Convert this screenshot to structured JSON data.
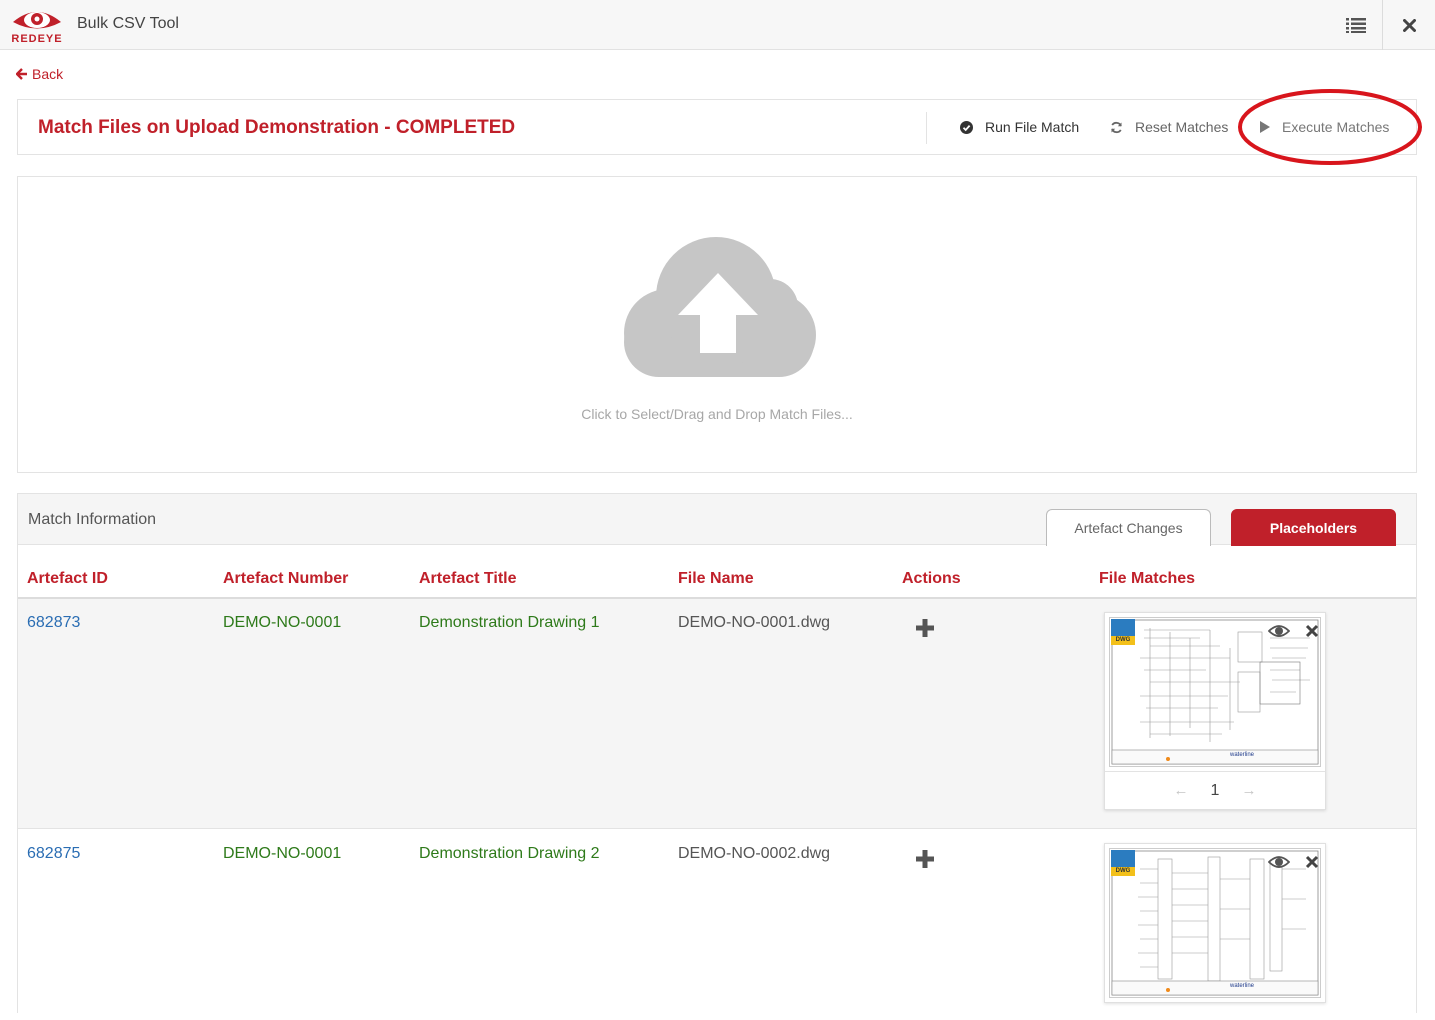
{
  "app": {
    "title": "Bulk CSV Tool",
    "logo_text": "REDEYE"
  },
  "icons": {
    "list": "list-icon",
    "close": "close-icon",
    "back": "arrow-left-icon",
    "run": "check-circle-icon",
    "reset": "refresh-icon",
    "execute": "play-icon",
    "upload": "cloud-upload-icon",
    "add": "plus-icon",
    "preview": "eye-icon",
    "remove": "x-icon",
    "prev": "arrow-left-icon",
    "next": "arrow-right-icon"
  },
  "colors": {
    "brand_red": "#c0202a",
    "link_blue": "#2a6db3",
    "value_green": "#2e7a1a"
  },
  "nav": {
    "back_label": "Back"
  },
  "header": {
    "title": "Match Files on Upload Demonstration - COMPLETED",
    "run_label": "Run File Match",
    "reset_label": "Reset Matches",
    "execute_label": "Execute Matches"
  },
  "upload": {
    "hint": "Click to Select/Drag and Drop Match Files..."
  },
  "match_info": {
    "title": "Match Information",
    "tabs": [
      {
        "label": "Artefact Changes",
        "active": false
      },
      {
        "label": "Placeholders",
        "active": true
      }
    ],
    "columns": [
      "Artefact ID",
      "Artefact Number",
      "Artefact Title",
      "File Name",
      "Actions",
      "File Matches"
    ],
    "rows": [
      {
        "id": "682873",
        "number": "DEMO-NO-0001",
        "title": "Demonstration Drawing 1",
        "file_name": "DEMO-NO-0001.dwg",
        "badge": "DWG",
        "page": "1"
      },
      {
        "id": "682875",
        "number": "DEMO-NO-0001",
        "title": "Demonstration Drawing 2",
        "file_name": "DEMO-NO-0002.dwg",
        "badge": "DWG"
      }
    ]
  }
}
